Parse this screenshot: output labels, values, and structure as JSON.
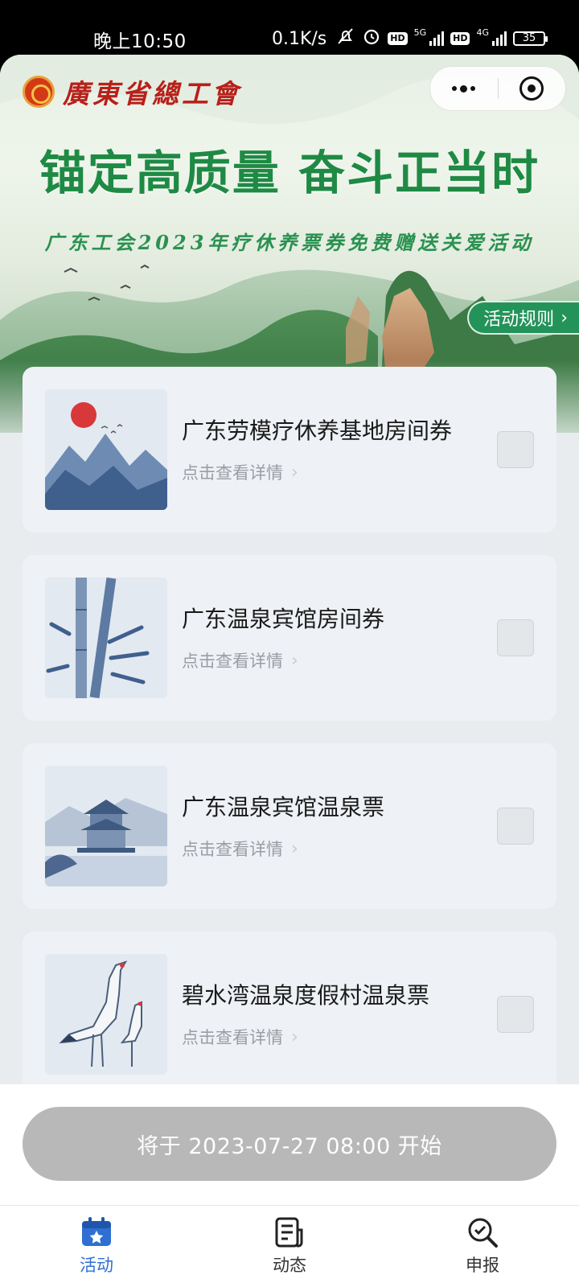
{
  "status_bar": {
    "time": "晚上10:50",
    "speed": "0.1K/s",
    "net1": "5G",
    "net2": "4G",
    "hd": "HD",
    "battery": "35"
  },
  "header": {
    "logo_text": "廣東省總工會",
    "slogan": "锚定高质量  奋斗正当时",
    "subtitle": "广东工会2023年疗休养票券免费赠送关爱活动",
    "rules_label": "活动规则"
  },
  "items": [
    {
      "title": "广东劳模疗休养基地房间券",
      "link": "点击查看详情",
      "thumb": "sun-mountains"
    },
    {
      "title": "广东温泉宾馆房间券",
      "link": "点击查看详情",
      "thumb": "bamboo"
    },
    {
      "title": "广东温泉宾馆温泉票",
      "link": "点击查看详情",
      "thumb": "pavilion"
    },
    {
      "title": "碧水湾温泉度假村温泉票",
      "link": "点击查看详情",
      "thumb": "cranes"
    }
  ],
  "start_button": "将于 2023-07-27 08:00 开始",
  "tabs": [
    {
      "label": "活动",
      "icon": "calendar-star-icon",
      "active": true
    },
    {
      "label": "动态",
      "icon": "news-icon",
      "active": false
    },
    {
      "label": "申报",
      "icon": "search-doc-icon",
      "active": false
    }
  ],
  "colors": {
    "accent_green": "#24935a",
    "slogan_green": "#1e8a44",
    "tab_active": "#2e6fd1",
    "button_disabled": "#b8b8b8"
  }
}
